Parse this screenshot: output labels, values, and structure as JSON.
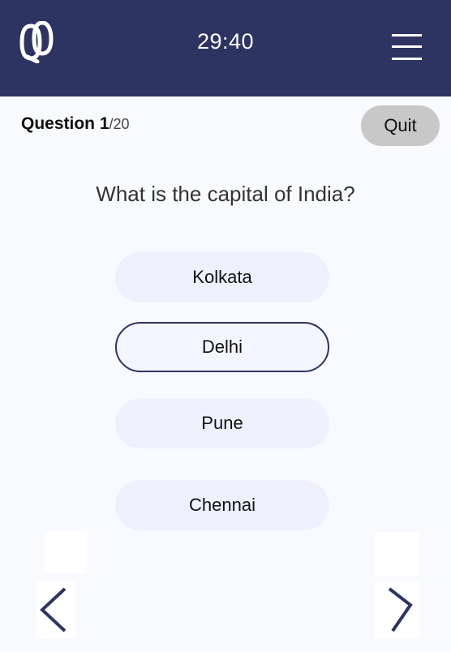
{
  "header": {
    "logo_icon": "quiz-logo-icon",
    "timer": "29:40",
    "menu_icon": "hamburger-menu-icon",
    "color": "#2d3462"
  },
  "quiz": {
    "question_label": "Question 1",
    "question_total": "/20",
    "quit_label": "Quit",
    "question_text": "What is the capital of India?",
    "options": [
      {
        "label": "Kolkata",
        "selected": false
      },
      {
        "label": "Delhi",
        "selected": true
      },
      {
        "label": "Pune",
        "selected": false
      },
      {
        "label": "Chennai",
        "selected": false
      }
    ]
  },
  "nav": {
    "prev_icon": "chevron-left-icon",
    "next_icon": "chevron-right-icon"
  }
}
